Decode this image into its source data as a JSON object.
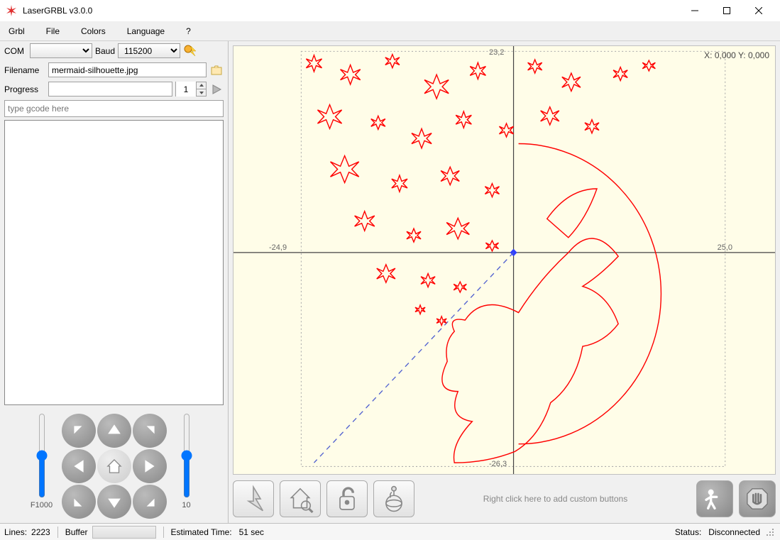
{
  "app": {
    "title": "LaserGRBL v3.0.0"
  },
  "menu": {
    "grbl": "Grbl",
    "file": "File",
    "colors": "Colors",
    "language": "Language",
    "help": "?"
  },
  "conn": {
    "com_label": "COM",
    "com_value": "",
    "baud_label": "Baud",
    "baud_value": "115200"
  },
  "file": {
    "label": "Filename",
    "value": "mermaid-silhouette.jpg"
  },
  "progress": {
    "label": "Progress",
    "value": "",
    "copies": "1"
  },
  "gcode_input": {
    "placeholder": "type gcode here"
  },
  "jog": {
    "left_slider_label": "F1000",
    "right_slider_label": "10"
  },
  "canvas": {
    "tick_top": "23,2",
    "tick_left": "-24,9",
    "tick_right": "25,0",
    "tick_bottom": "-26,3",
    "readout": "X: 0,000 Y: 0,000"
  },
  "toolbar": {
    "hint": "Right click here to add custom buttons"
  },
  "status": {
    "lines_label": "Lines:",
    "lines_value": "2223",
    "buffer_label": "Buffer",
    "eta_label": "Estimated Time:",
    "eta_value": "51 sec",
    "status_label": "Status:",
    "status_value": "Disconnected"
  }
}
